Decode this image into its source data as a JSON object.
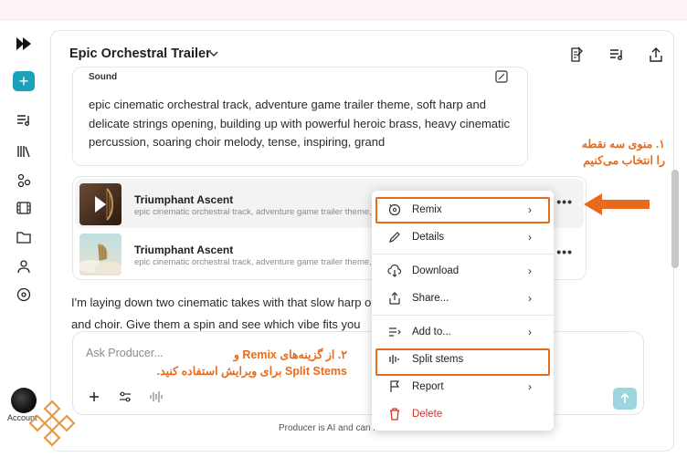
{
  "header": {
    "title": "Epic Orchestral Trailer"
  },
  "sidebar": {
    "account_label": "Account"
  },
  "sound": {
    "label": "Sound",
    "text": "epic cinematic orchestral track, adventure game trailer theme, soft harp and delicate strings opening, building up with powerful heroic brass, heavy cinematic percussion, soaring choir melody, tense, inspiring, grand"
  },
  "tracks": [
    {
      "title": "Triumphant Ascent",
      "desc": "epic cinematic orchestral track, adventure game trailer theme, soft harp and"
    },
    {
      "title": "Triumphant Ascent",
      "desc": "epic cinematic orchestral track, adventure game trailer theme, soft harp and"
    }
  ],
  "chat": {
    "line1": "I'm laying down two cinematic takes with that slow harp opening leading into that brass",
    "line2": "and choir. Give them a spin and see which vibe fits you"
  },
  "input": {
    "placeholder": "Ask Producer..."
  },
  "footer": {
    "disclaimer": "Producer is AI and can make mistakes"
  },
  "menu": {
    "items": [
      {
        "label": "Remix"
      },
      {
        "label": "Details"
      },
      {
        "label": "Download"
      },
      {
        "label": "Share..."
      },
      {
        "label": "Add to..."
      },
      {
        "label": "Split stems"
      },
      {
        "label": "Report"
      },
      {
        "label": "Delete"
      }
    ]
  },
  "annotations": {
    "step1_line1": "۱. منوی سه نقطه",
    "step1_line2": "را انتخاب می‌کنیم",
    "step2_line1": "۲. از گزینه‌های Remix و",
    "step2_line2": "Split Stems برای ویرایش استفاده کنید."
  },
  "colors": {
    "accent": "#1aa3b8",
    "annotation": "#e86b1d",
    "delete": "#d93025"
  }
}
